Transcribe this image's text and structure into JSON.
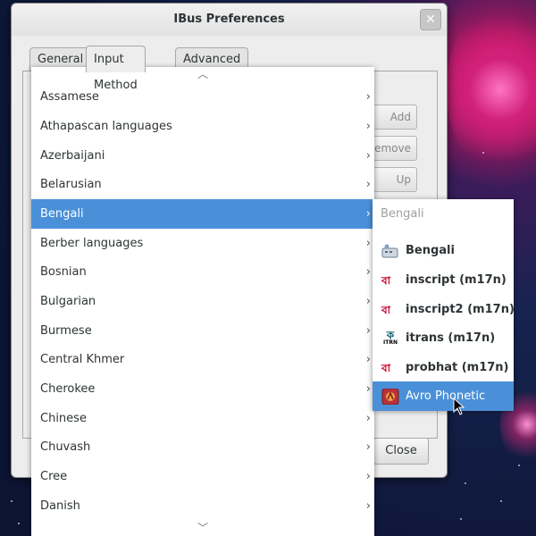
{
  "window": {
    "title": "IBus Preferences",
    "close_glyph": "✕"
  },
  "tabs": [
    {
      "label": "General"
    },
    {
      "label": "Input Method"
    },
    {
      "label": "Advanced"
    }
  ],
  "side_buttons": [
    {
      "label": "Add"
    },
    {
      "label": "Remove"
    },
    {
      "label": "Up"
    }
  ],
  "dialog_close_label": "Close",
  "menu": {
    "scroll_up": "︿",
    "scroll_down": "﹀",
    "chevron": "›",
    "items": [
      {
        "label": "Assamese"
      },
      {
        "label": "Athapascan languages"
      },
      {
        "label": "Azerbaijani"
      },
      {
        "label": "Belarusian"
      },
      {
        "label": "Bengali"
      },
      {
        "label": "Berber languages"
      },
      {
        "label": "Bosnian"
      },
      {
        "label": "Bulgarian"
      },
      {
        "label": "Burmese"
      },
      {
        "label": "Central Khmer"
      },
      {
        "label": "Cherokee"
      },
      {
        "label": "Chinese"
      },
      {
        "label": "Chuvash"
      },
      {
        "label": "Cree"
      },
      {
        "label": "Danish"
      }
    ],
    "selected_label": "Bengali"
  },
  "submenu": {
    "header": "Bengali",
    "items": [
      {
        "label": "Bengali",
        "icon": "keyboard-icon"
      },
      {
        "label": "inscript (m17n)",
        "icon": "bengali-script-icon"
      },
      {
        "label": "inscript2 (m17n)",
        "icon": "bengali-script-icon"
      },
      {
        "label": "itrans (m17n)",
        "icon": "itrans-icon"
      },
      {
        "label": "probhat (m17n)",
        "icon": "bengali-script-icon"
      },
      {
        "label": "Avro Phonetic",
        "icon": "avro-icon"
      }
    ],
    "selected_label": "Avro Phonetic"
  },
  "icon_glyphs": {
    "bengali_script": "বা",
    "itrans": "ক",
    "itrans_caption": "ITRN"
  },
  "colors": {
    "selection": "#4a90d9",
    "menu_bg": "#ffffff",
    "window_bg": "#ededed"
  }
}
